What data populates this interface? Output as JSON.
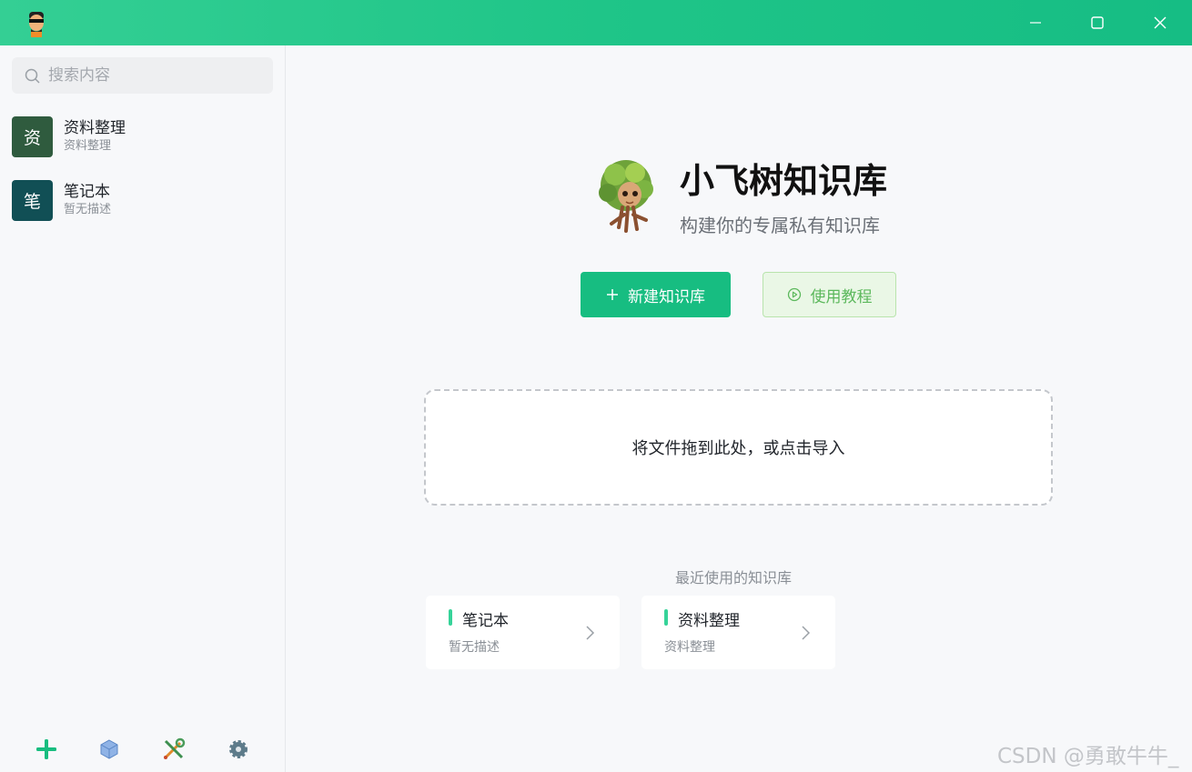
{
  "titlebar": {
    "avatar_icon": "cartoon-avatar-icon",
    "controls": [
      "minimize-icon",
      "maximize-icon",
      "close-icon"
    ]
  },
  "sidebar": {
    "search": {
      "placeholder": "搜索内容",
      "value": ""
    },
    "items": [
      {
        "badge": "资",
        "title": "资料整理",
        "subtitle": "资料整理",
        "color": "#2f5b3e"
      },
      {
        "badge": "笔",
        "title": "笔记本",
        "subtitle": "暂无描述",
        "color": "#114f55"
      }
    ],
    "footer_icons": [
      "add-icon",
      "cube-icon",
      "tools-icon",
      "gear-icon"
    ]
  },
  "main": {
    "brand": {
      "title": "小飞树知识库",
      "subtitle": "构建你的专属私有知识库",
      "mascot_icon": "tree-mascot-icon"
    },
    "new_button": "新建知识库",
    "tutorial_button": "使用教程",
    "dropzone_text": "将文件拖到此处，或点击导入",
    "recent_label": "最近使用的知识库",
    "recent": [
      {
        "title": "笔记本",
        "subtitle": "暂无描述"
      },
      {
        "title": "资料整理",
        "subtitle": "资料整理"
      }
    ]
  },
  "watermark": "CSDN @勇敢牛牛_",
  "colors": {
    "accent": "#17bd81",
    "tutorial": "#5cb85c",
    "titlebar": "#1fc588"
  }
}
